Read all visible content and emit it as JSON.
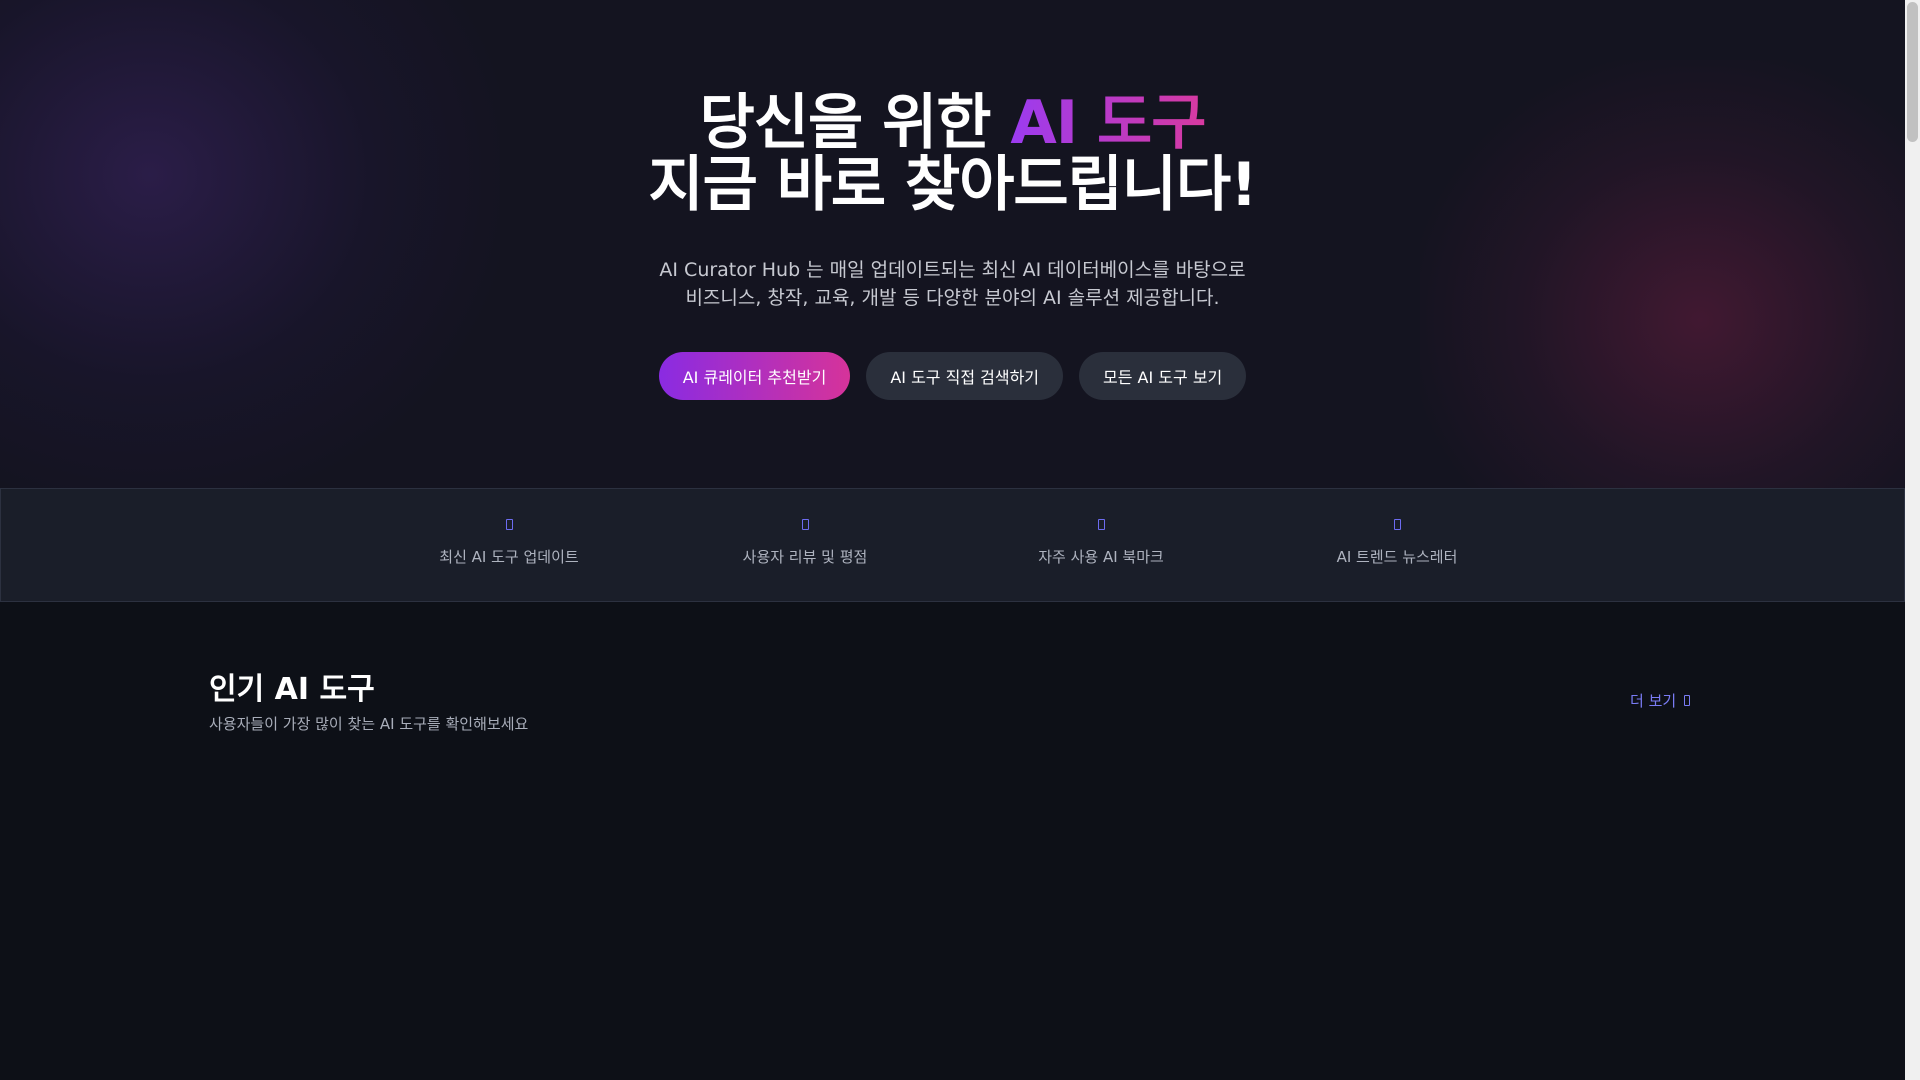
{
  "hero": {
    "title_line1_prefix": "당신을 위한 ",
    "title_line1_accent": "AI 도구",
    "title_line2": "지금 바로 찾아드립니다!",
    "desc_line1": "AI Curator Hub 는 매일 업데이트되는 최신 AI 데이터베이스를 바탕으로",
    "desc_line2": "비즈니스, 창작, 교육, 개발 등 다양한 분야의 AI 솔루션 제공합니다.",
    "buttons": [
      {
        "label": "AI 큐레이터 추천받기"
      },
      {
        "label": "AI 도구 직접 검색하기"
      },
      {
        "label": "모든 AI 도구 보기"
      }
    ],
    "colors": {
      "accent_start": "#9b3bf0",
      "accent_end": "#d83aa0"
    }
  },
  "features": [
    {
      "label": "최신 AI 도구 업데이트",
      "icon": "update-icon"
    },
    {
      "label": "사용자 리뷰 및 평점",
      "icon": "review-icon"
    },
    {
      "label": "자주 사용 AI 북마크",
      "icon": "bookmark-icon"
    },
    {
      "label": "AI 트렌드 뉴스레터",
      "icon": "newsletter-icon"
    }
  ],
  "popular": {
    "title": "인기 AI 도구",
    "subtitle": "사용자들이 가장 많이 찾는 AI 도구를 확인해보세요",
    "more_label": "더 보기"
  }
}
